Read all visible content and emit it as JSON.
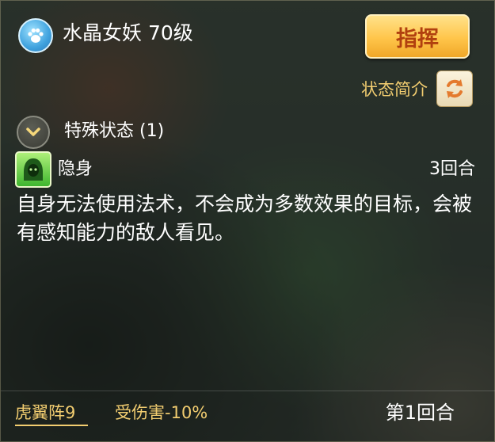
{
  "unit": {
    "icon": "paw-icon",
    "name": "水晶女妖 70级"
  },
  "command_button": {
    "label": "指挥"
  },
  "status_intro": {
    "label": "状态简介",
    "button_icon": "refresh-icon"
  },
  "special_status": {
    "title": "特殊状态 (1)",
    "toggle_icon": "chevron-down-icon",
    "items": [
      {
        "icon": "stealth-icon",
        "name": "隐身",
        "duration": "3回合",
        "description": "自身无法使用法术，不会成为多数效果的目标，会被有感知能力的敌人看见。"
      }
    ]
  },
  "footer": {
    "formation": "虎翼阵9",
    "formation_effect": "受伤害-10%",
    "round": "第1回合"
  },
  "colors": {
    "accent_gold": "#f2cd70",
    "button_text": "#b1400f",
    "stealth_icon_green": "#3fb62f"
  }
}
